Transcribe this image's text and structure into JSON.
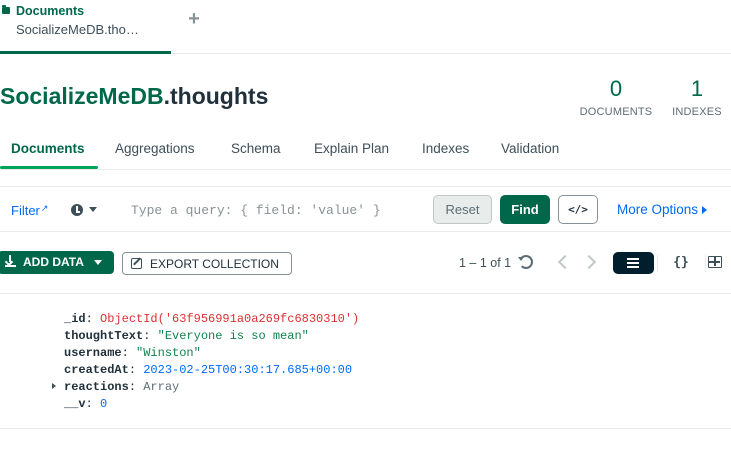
{
  "tab": {
    "title": "Documents",
    "subtitle": "SocializeMeDB.thoughts",
    "add_label": "+"
  },
  "collection": {
    "db": "SocializeMeDB",
    "name": ".thoughts",
    "documents_count": "0",
    "documents_label": "DOCUMENTS",
    "indexes_count": "1",
    "indexes_label": "INDEXES"
  },
  "subtabs": [
    "Documents",
    "Aggregations",
    "Schema",
    "Explain Plan",
    "Indexes",
    "Validation"
  ],
  "query": {
    "filter_label": "Filter",
    "placeholder": "Type a query: { field: 'value' }",
    "reset_label": "Reset",
    "find_label": "Find",
    "code_label": "</>",
    "more_options_label": "More Options"
  },
  "toolbar": {
    "add_data_label": "ADD DATA",
    "export_label": "EXPORT COLLECTION",
    "pagination": "1 – 1 of 1",
    "json_view_label": "{}"
  },
  "document": {
    "fields": [
      {
        "key": "_id",
        "value": "ObjectId('63f956991a0a269fc6830310')",
        "type": "objectid"
      },
      {
        "key": "thoughtText",
        "value": "\"Everyone is so mean\"",
        "type": "string"
      },
      {
        "key": "username",
        "value": "\"Winston\"",
        "type": "string"
      },
      {
        "key": "createdAt",
        "value": "2023-02-25T00:30:17.685+00:00",
        "type": "date"
      },
      {
        "key": "reactions",
        "value": "Array",
        "type": "array"
      },
      {
        "key": "__v",
        "value": "0",
        "type": "number"
      }
    ]
  },
  "colors": {
    "brand_green": "#00684a",
    "link_blue": "#016bf8",
    "objectid_red": "#db3030",
    "string_green": "#12824d"
  }
}
